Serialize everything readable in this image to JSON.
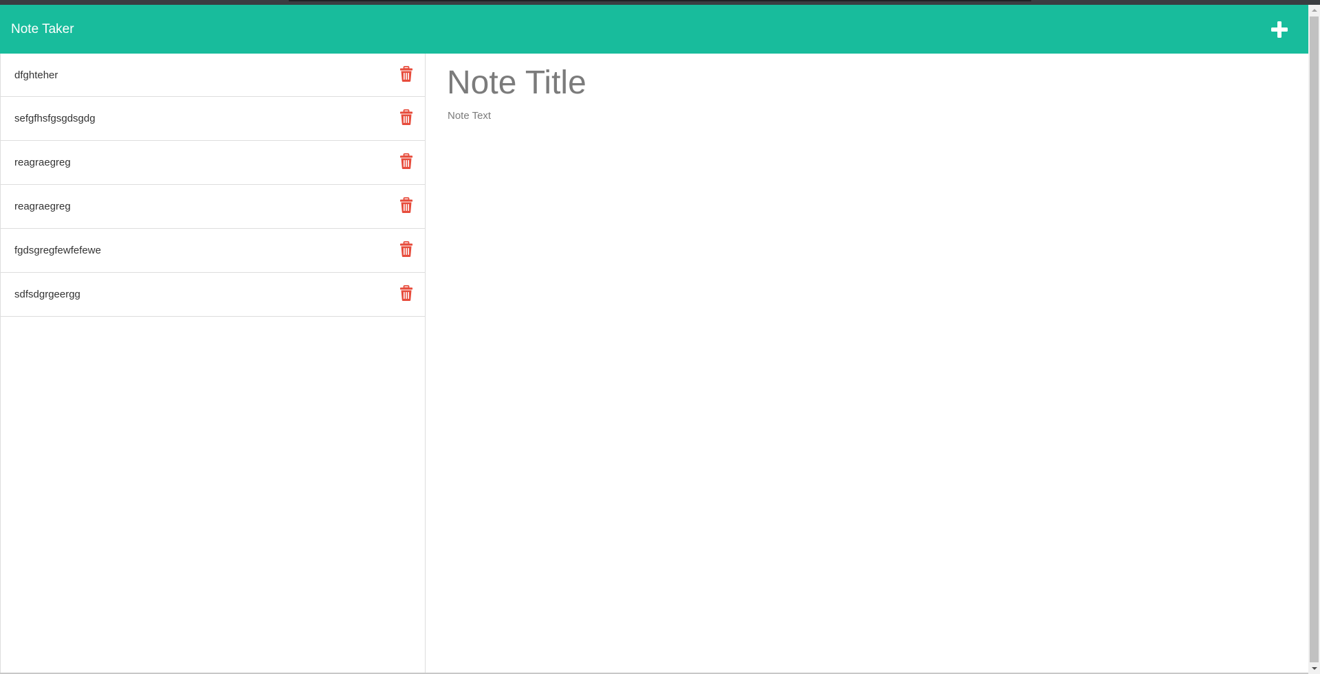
{
  "colors": {
    "navbar": "#18bc9c",
    "delete_icon": "#e74c3c",
    "text": "#333333",
    "placeholder": "#7b7b7b"
  },
  "header": {
    "title": "Note Taker",
    "new_note_icon": "plus-icon"
  },
  "notes": [
    {
      "title": "dfghteher",
      "delete_icon": "trash-icon"
    },
    {
      "title": "sefgfhsfgsgdsgdg",
      "delete_icon": "trash-icon"
    },
    {
      "title": "reagraegreg",
      "delete_icon": "trash-icon"
    },
    {
      "title": "reagraegreg",
      "delete_icon": "trash-icon"
    },
    {
      "title": "fgdsgregfewfefewe",
      "delete_icon": "trash-icon"
    },
    {
      "title": "sdfsdgrgeergg",
      "delete_icon": "trash-icon"
    }
  ],
  "editor": {
    "title_value": "",
    "title_placeholder": "Note Title",
    "text_value": "",
    "text_placeholder": "Note Text"
  }
}
